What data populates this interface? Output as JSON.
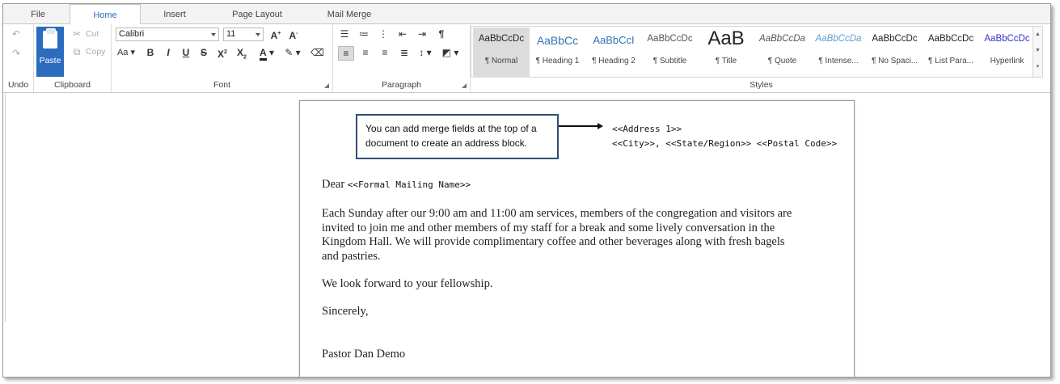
{
  "tabs": [
    "File",
    "Home",
    "Insert",
    "Page Layout",
    "Mail Merge"
  ],
  "undo_group": {
    "label": "Undo"
  },
  "clipboard": {
    "label": "Clipboard",
    "paste": "Paste",
    "cut": "Cut",
    "copy": "Copy"
  },
  "font": {
    "label": "Font",
    "family": "Calibri",
    "size": "11"
  },
  "paragraph": {
    "label": "Paragraph"
  },
  "styles": {
    "label": "Styles",
    "items": [
      {
        "sample": "AaBbCcDc",
        "name": "¶ Normal",
        "color": "#222222"
      },
      {
        "sample": "AaBbCc",
        "name": "¶ Heading 1",
        "color": "#2e74b5"
      },
      {
        "sample": "AaBbCcI",
        "name": "¶ Heading 2",
        "color": "#2e74b5"
      },
      {
        "sample": "AaBbCcDc",
        "name": "¶ Subtitle",
        "color": "#555555"
      },
      {
        "sample": "AaB",
        "name": "¶ Title",
        "color": "#222222"
      },
      {
        "sample": "AaBbCcDa",
        "name": "¶ Quote",
        "color": "#555555"
      },
      {
        "sample": "AaBbCcDa",
        "name": "¶ Intense...",
        "color": "#5b9bd5"
      },
      {
        "sample": "AaBbCcDc",
        "name": "¶ No Spaci...",
        "color": "#222222"
      },
      {
        "sample": "AaBbCcDc",
        "name": "¶ List Para...",
        "color": "#222222"
      },
      {
        "sample": "AaBbCcDc",
        "name": "Hyperlink",
        "color": "#3333cc"
      }
    ]
  },
  "document": {
    "callout": "You can add merge fields at the top of a document to create an address block.",
    "address_line1": "<<Address 1>>",
    "address_line2": "<<City>>, <<State/Region>> <<Postal Code>>",
    "salutation": "Dear",
    "salutation_field": "<<Formal Mailing Name>>",
    "paragraph1_lines": [
      "Each Sunday after our 9:00 am and 11:00 am services, members of the congregation and visitors are",
      "invited to join me and other members of my staff for a break and some lively conversation in the",
      "Kingdom Hall. We will provide complimentary coffee and other beverages along with fresh bagels",
      "and pastries."
    ],
    "paragraph2": "We look forward to your fellowship.",
    "closing": "Sincerely,",
    "signature": "Pastor Dan Demo"
  }
}
